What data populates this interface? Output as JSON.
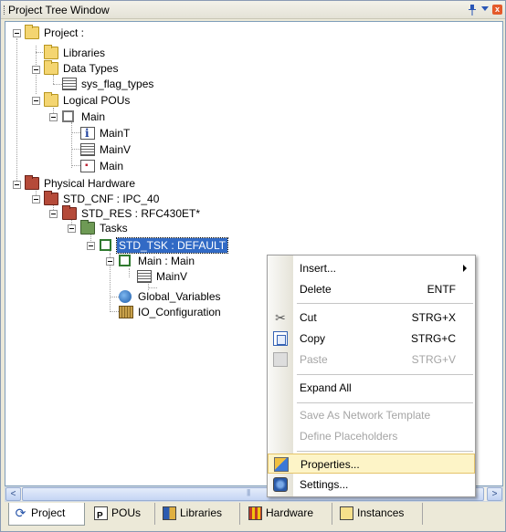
{
  "window": {
    "title": "Project Tree Window",
    "close_glyph": "x"
  },
  "tree": {
    "project": "Project :",
    "libraries": "Libraries",
    "data_types": "Data Types",
    "sys_flag_types": "sys_flag_types",
    "logical_pous": "Logical POUs",
    "main": "Main",
    "main_t": "MainT",
    "main_v": "MainV",
    "main_code": "Main",
    "physical_hardware": "Physical Hardware",
    "std_cnf": "STD_CNF : IPC_40",
    "std_res": "STD_RES : RFC430ET*",
    "tasks": "Tasks",
    "std_tsk": "STD_TSK : DEFAULT",
    "main_main": "Main : Main",
    "main_v_instance": "MainV",
    "global_variables": "Global_Variables",
    "io_configuration": "IO_Configuration"
  },
  "context_menu": {
    "insert": "Insert...",
    "delete": "Delete",
    "delete_shortcut": "ENTF",
    "cut": "Cut",
    "cut_shortcut": "STRG+X",
    "copy": "Copy",
    "copy_shortcut": "STRG+C",
    "paste": "Paste",
    "paste_shortcut": "STRG+V",
    "expand_all": "Expand All",
    "save_as_network_template": "Save As Network Template",
    "define_placeholders": "Define Placeholders",
    "properties": "Properties...",
    "settings": "Settings..."
  },
  "tabs": {
    "project": "Project",
    "pous": "POUs",
    "libraries": "Libraries",
    "hardware": "Hardware",
    "instances": "Instances"
  },
  "scroll": {
    "left": "<",
    "right": ">"
  },
  "icons": {
    "pin": "pin-icon",
    "menu_arrow": "dropdown-arrow-icon",
    "close": "close-icon",
    "cut": "scissors-icon",
    "copy": "copy-icon",
    "paste": "paste-icon",
    "properties": "properties-icon",
    "settings": "settings-icon",
    "project_tab": "project-icon"
  },
  "colors": {
    "selection": "#316ac5",
    "menu_hover": "#fdf4c7",
    "close_button": "#e45a2b"
  }
}
